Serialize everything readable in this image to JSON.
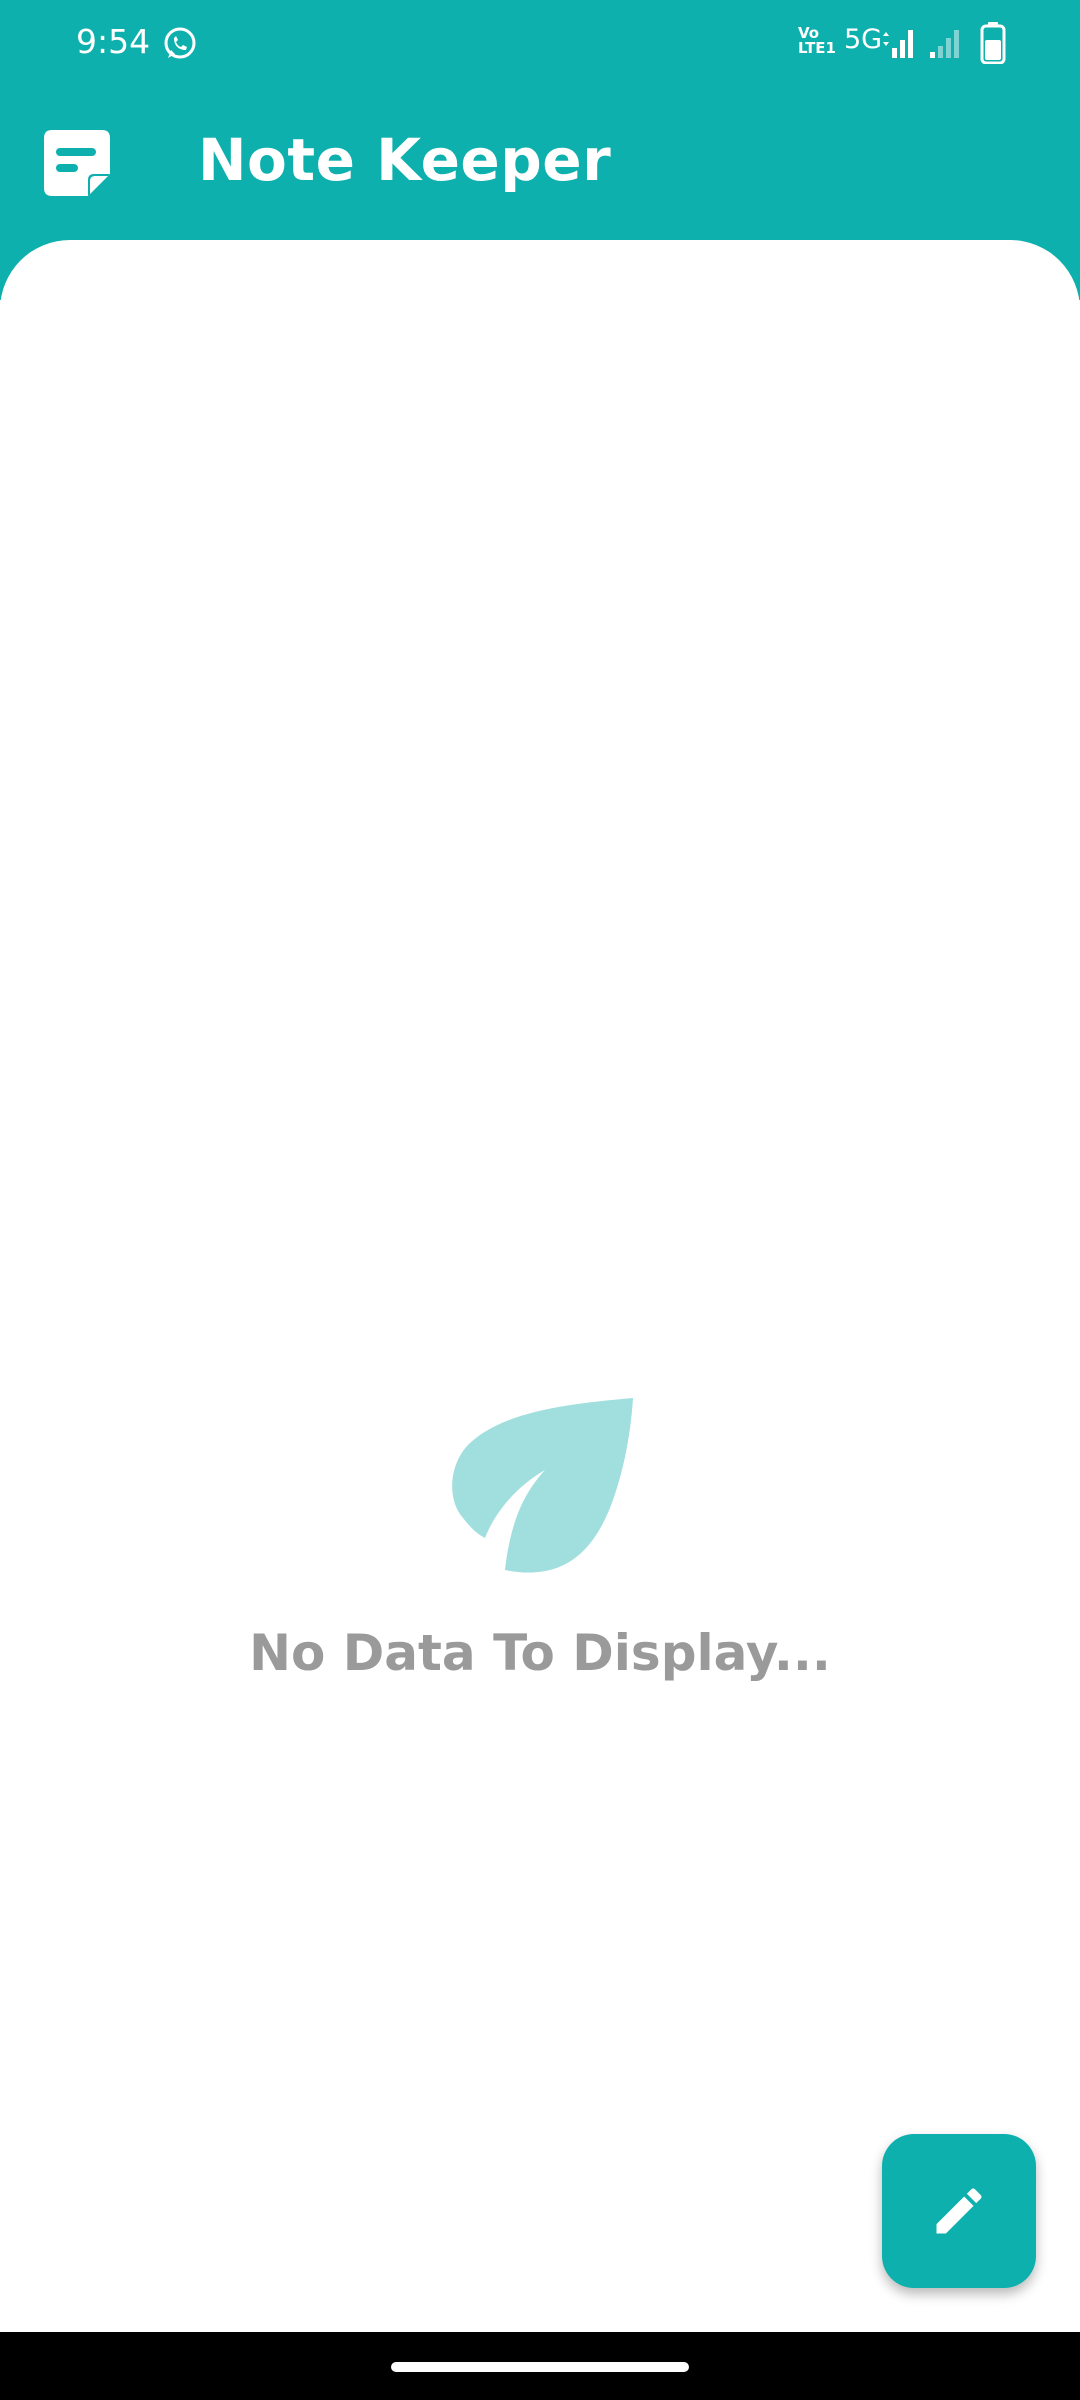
{
  "status_bar": {
    "time": "9:54",
    "volte_label": "VoLTE1",
    "network_type": "5G",
    "icons": [
      "whatsapp-icon",
      "signal-icon",
      "signal-icon",
      "battery-icon"
    ]
  },
  "app_bar": {
    "title": "Note Keeper",
    "logo_icon": "note-icon"
  },
  "empty_state": {
    "icon": "leaf-icon",
    "message": "No Data To Display..."
  },
  "fab": {
    "icon": "pencil-icon"
  },
  "colors": {
    "primary": "#0eb0ae",
    "leaf": "#a1dfde",
    "empty_text": "#9a9a9a",
    "background": "#ffffff"
  }
}
